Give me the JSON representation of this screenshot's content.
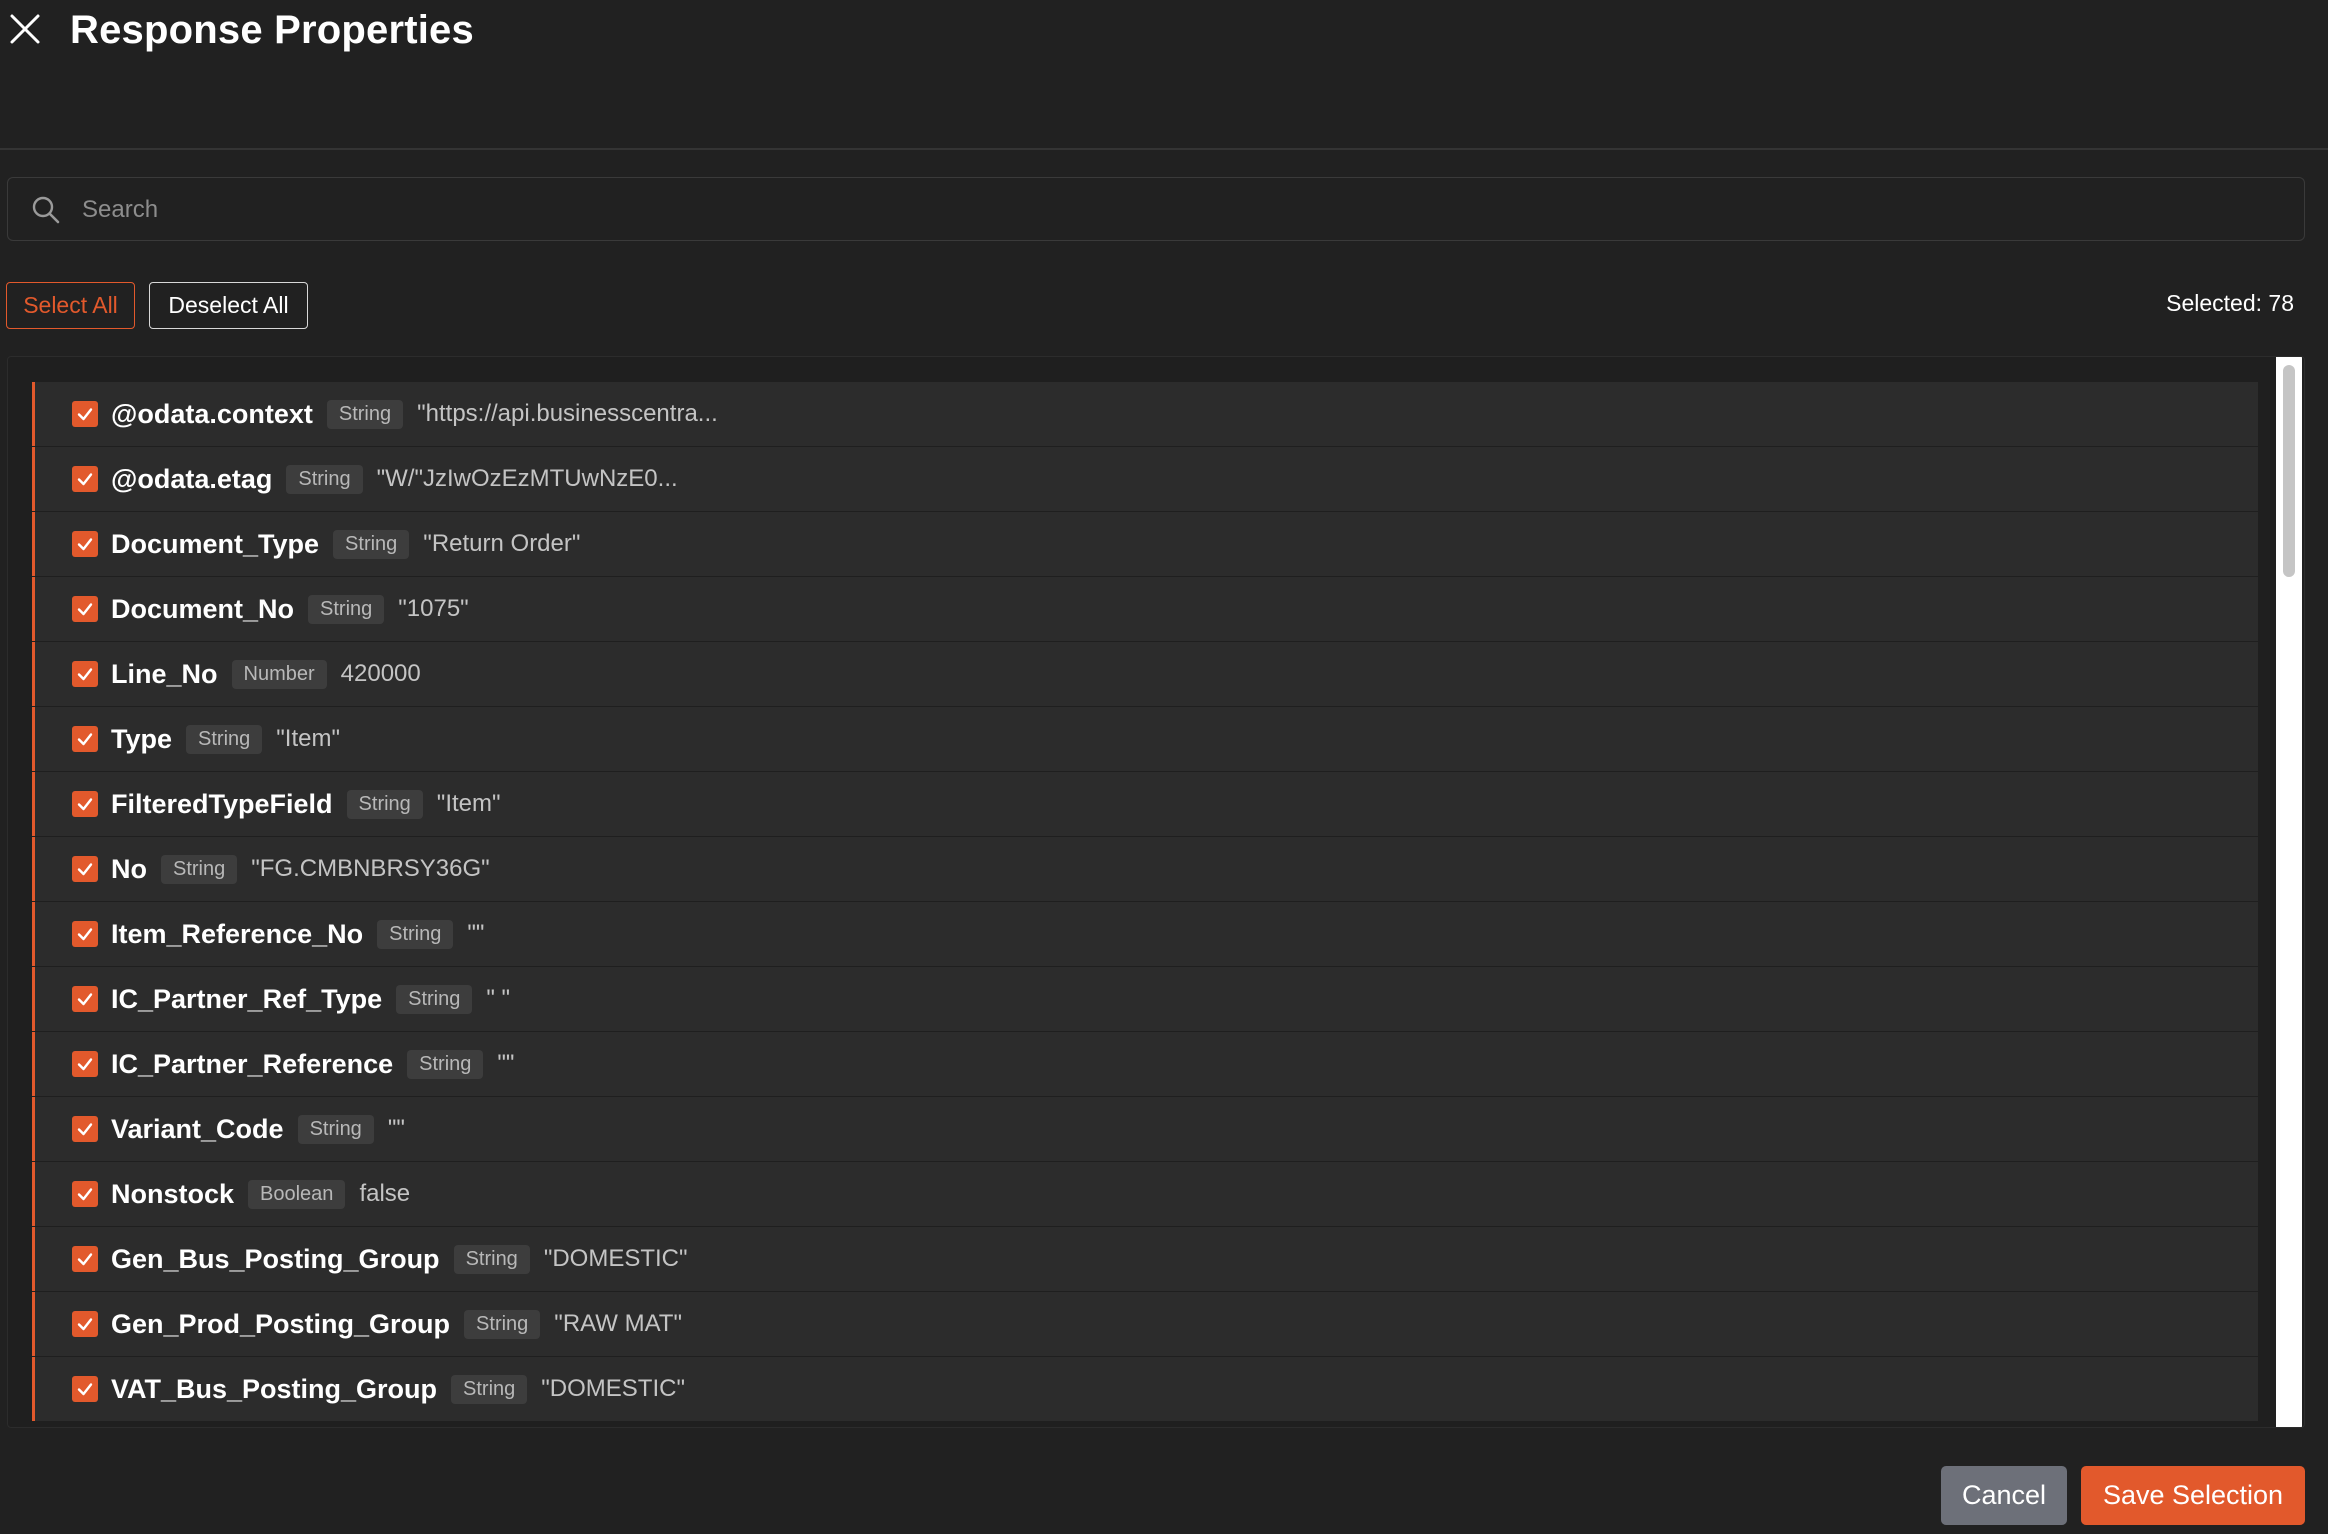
{
  "dialog": {
    "title": "Response Properties",
    "close_icon": "close-icon"
  },
  "search": {
    "placeholder": "Search",
    "value": "",
    "icon": "search-icon"
  },
  "toolbar": {
    "select_all_label": "Select All",
    "deselect_all_label": "Deselect All",
    "selected_text": "Selected: 78"
  },
  "properties": [
    {
      "name": "@odata.context",
      "type": "String",
      "value": "\"https://api.businesscentra...",
      "checked": true
    },
    {
      "name": "@odata.etag",
      "type": "String",
      "value": "\"W/\"JzIwOzEzMTUwNzE0...",
      "checked": true
    },
    {
      "name": "Document_Type",
      "type": "String",
      "value": "\"Return Order\"",
      "checked": true
    },
    {
      "name": "Document_No",
      "type": "String",
      "value": "\"1075\"",
      "checked": true
    },
    {
      "name": "Line_No",
      "type": "Number",
      "value": "420000",
      "checked": true
    },
    {
      "name": "Type",
      "type": "String",
      "value": "\"Item\"",
      "checked": true
    },
    {
      "name": "FilteredTypeField",
      "type": "String",
      "value": "\"Item\"",
      "checked": true
    },
    {
      "name": "No",
      "type": "String",
      "value": "\"FG.CMBNBRSY36G\"",
      "checked": true
    },
    {
      "name": "Item_Reference_No",
      "type": "String",
      "value": "\"\"",
      "checked": true
    },
    {
      "name": "IC_Partner_Ref_Type",
      "type": "String",
      "value": "\" \"",
      "checked": true
    },
    {
      "name": "IC_Partner_Reference",
      "type": "String",
      "value": "\"\"",
      "checked": true
    },
    {
      "name": "Variant_Code",
      "type": "String",
      "value": "\"\"",
      "checked": true
    },
    {
      "name": "Nonstock",
      "type": "Boolean",
      "value": "false",
      "checked": true
    },
    {
      "name": "Gen_Bus_Posting_Group",
      "type": "String",
      "value": "\"DOMESTIC\"",
      "checked": true
    },
    {
      "name": "Gen_Prod_Posting_Group",
      "type": "String",
      "value": "\"RAW MAT\"",
      "checked": true
    },
    {
      "name": "VAT_Bus_Posting_Group",
      "type": "String",
      "value": "\"DOMESTIC\"",
      "checked": true
    }
  ],
  "footer": {
    "cancel_label": "Cancel",
    "save_label": "Save Selection"
  },
  "colors": {
    "accent": "#e2592c",
    "background": "#212121",
    "row_background": "#2c2c2c",
    "cancel_background": "#6d7079"
  }
}
